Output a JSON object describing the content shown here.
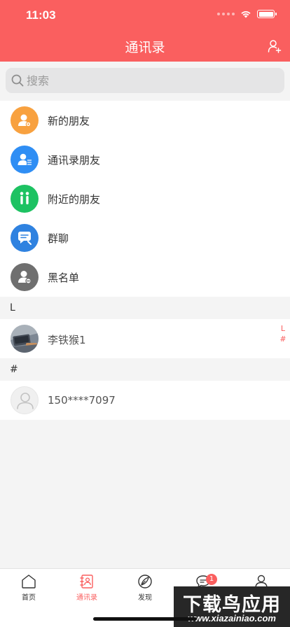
{
  "status_bar": {
    "time": "11:03"
  },
  "nav": {
    "title": "通讯录",
    "add_icon": "add-friend-icon"
  },
  "search": {
    "placeholder": "搜索",
    "value": ""
  },
  "menu": [
    {
      "label": "新的朋友",
      "icon": "new-friend-icon",
      "color": "#f8a13f"
    },
    {
      "label": "通讯录朋友",
      "icon": "contacts-friend-icon",
      "color": "#2f8ef4"
    },
    {
      "label": "附近的朋友",
      "icon": "nearby-friend-icon",
      "color": "#1dc262"
    },
    {
      "label": "群聊",
      "icon": "group-chat-icon",
      "color": "#2f82e0"
    },
    {
      "label": "黑名单",
      "icon": "blacklist-icon",
      "color": "#6f6f6f"
    }
  ],
  "sections": [
    {
      "letter": "L",
      "contacts": [
        {
          "name": "李铁猴1",
          "avatar": "photo-avatar"
        }
      ]
    },
    {
      "letter": "#",
      "contacts": [
        {
          "name": "150****7097",
          "avatar": "default-avatar"
        }
      ]
    }
  ],
  "index_bar": [
    "L",
    "#"
  ],
  "tabbar": {
    "active": "通讯录",
    "tabs": [
      {
        "label": "首页",
        "icon": "home-icon"
      },
      {
        "label": "通讯录",
        "icon": "contacts-icon"
      },
      {
        "label": "发现",
        "icon": "discover-icon"
      },
      {
        "label": "",
        "icon": "chat-icon",
        "badge": "1"
      },
      {
        "label": "",
        "icon": "profile-icon"
      }
    ]
  },
  "watermark": {
    "title": "下载鸟应用",
    "url": "www.xiazainiao.com"
  },
  "colors": {
    "accent": "#fa5f5f",
    "background": "#f4f4f4"
  }
}
